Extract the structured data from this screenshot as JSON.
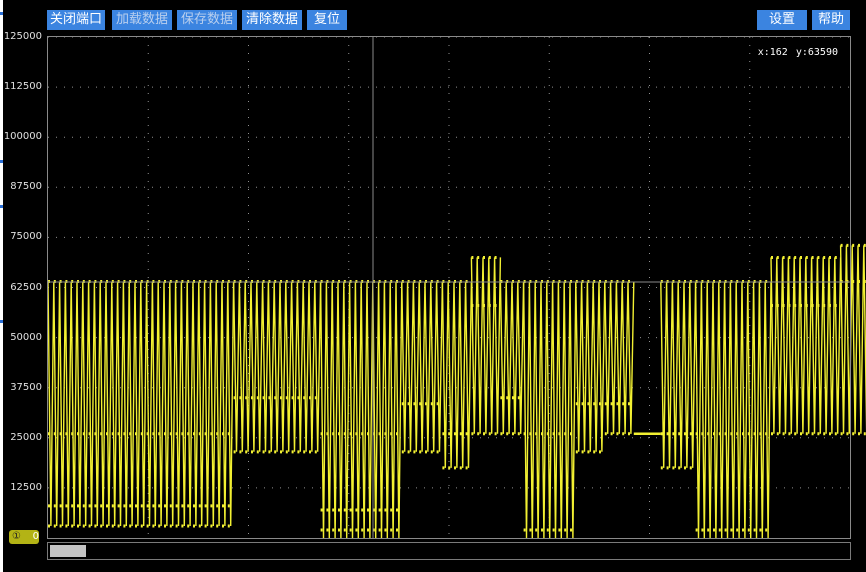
{
  "toolbar": {
    "close_port": "关闭端口",
    "load_data": "加载数据",
    "save_data": "保存数据",
    "clear_data": "清除数据",
    "reset": "复位",
    "settings": "设置",
    "help": "帮助"
  },
  "readout": {
    "x": "x:162",
    "y": "y:63590"
  },
  "channel": {
    "number": "①",
    "value": "0"
  },
  "colors": {
    "trace": "#f2f032",
    "button": "#3b84e0",
    "grid": "#909090",
    "axis": "#8a8a8a"
  },
  "chart_data": {
    "type": "line",
    "title": "",
    "xlabel": "",
    "ylabel": "",
    "ylim": [
      0,
      125000
    ],
    "yticks": [
      "125000",
      "112500",
      "100000",
      "87500",
      "75000",
      "62500",
      "50000",
      "37500",
      "25000",
      "12500"
    ],
    "grid": true,
    "cursor": {
      "x": 162,
      "y": 63590
    },
    "series": [
      {
        "segments": [
          {
            "n": 14,
            "hi": 64000,
            "lo": 3000,
            "mid": 26000,
            "low_marker": 8000
          },
          {
            "n": 18,
            "hi": 64000,
            "lo": 3000,
            "mid": 26000,
            "low_marker": 8000
          },
          {
            "n": 15,
            "hi": 64000,
            "lo": 21500,
            "mid": 35000
          },
          {
            "n": 14,
            "hi": 64000,
            "lo": 0,
            "mid": 26000,
            "low_marker": 7000
          },
          {
            "n": 7,
            "hi": 64000,
            "lo": 21500,
            "mid": 33500
          },
          {
            "n": 5,
            "hi": 64000,
            "lo": 17500,
            "mid": 26000
          },
          {
            "n": 5,
            "hi": 70000,
            "lo": 26000,
            "mid": 58000
          },
          {
            "n": 4,
            "hi": 64000,
            "lo": 26000,
            "mid": 35000
          },
          {
            "n": 9,
            "hi": 64000,
            "lo": 0,
            "mid": 26000
          },
          {
            "n": 5,
            "hi": 64000,
            "lo": 21500,
            "mid": 33500
          },
          {
            "n": 5,
            "hi": 64000,
            "lo": 26000,
            "mid": 33500
          },
          {
            "n": 0,
            "hi": 26000,
            "lo": 26000,
            "flat": true
          },
          {
            "n": 6,
            "hi": 64000,
            "lo": 17500,
            "mid": 26000
          },
          {
            "n": 13,
            "hi": 64000,
            "lo": 0,
            "mid": 26000
          },
          {
            "n": 12,
            "hi": 70000,
            "lo": 26000,
            "mid": 58000
          },
          {
            "n": 6,
            "hi": 73000,
            "lo": 26000,
            "mid": 64000
          },
          {
            "n": 5,
            "hi": 70000,
            "lo": 26000,
            "mid": 58000
          },
          {
            "n": 8,
            "hi": 64000,
            "lo": 26000,
            "mid": 35000
          },
          {
            "n": 4,
            "hi": 64000,
            "lo": 21500,
            "mid": 35000
          }
        ]
      }
    ]
  }
}
